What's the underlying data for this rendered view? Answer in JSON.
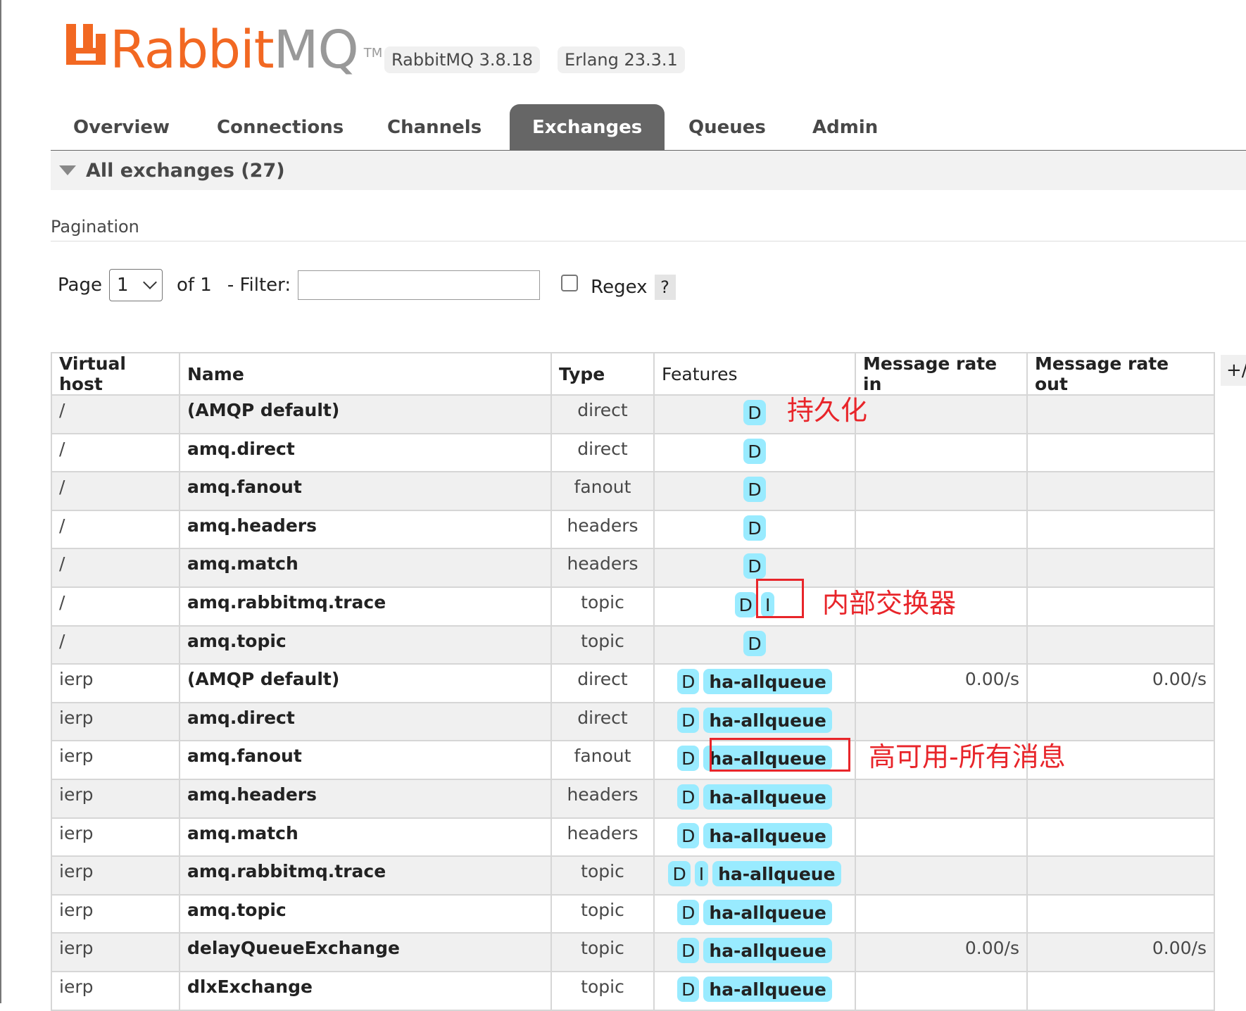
{
  "header": {
    "logo_text_rabbit": "Rabbit",
    "logo_text_mq": "MQ",
    "logo_tm": "TM",
    "version": "RabbitMQ 3.8.18",
    "erlang": "Erlang 23.3.1",
    "brand_color": "#f26822"
  },
  "tabs": [
    {
      "label": "Overview",
      "active": false
    },
    {
      "label": "Connections",
      "active": false
    },
    {
      "label": "Channels",
      "active": false
    },
    {
      "label": "Exchanges",
      "active": true
    },
    {
      "label": "Queues",
      "active": false
    },
    {
      "label": "Admin",
      "active": false
    }
  ],
  "section": {
    "title": "All exchanges (27)"
  },
  "pagination": {
    "label": "Pagination",
    "page_label": "Page",
    "page_value": "1",
    "of_label": "of 1",
    "filter_label": "- Filter:",
    "filter_value": "",
    "regex_label": "Regex",
    "regex_checked": false,
    "help_label": "?"
  },
  "table": {
    "columns": [
      "Virtual host",
      "Name",
      "Type",
      "Features",
      "Message rate in",
      "Message rate out"
    ],
    "toggle_label": "+/-",
    "rows": [
      {
        "vhost": "/",
        "name": "(AMQP default)",
        "type": "direct",
        "features": [
          "D"
        ],
        "policy": "",
        "rate_in": "",
        "rate_out": ""
      },
      {
        "vhost": "/",
        "name": "amq.direct",
        "type": "direct",
        "features": [
          "D"
        ],
        "policy": "",
        "rate_in": "",
        "rate_out": ""
      },
      {
        "vhost": "/",
        "name": "amq.fanout",
        "type": "fanout",
        "features": [
          "D"
        ],
        "policy": "",
        "rate_in": "",
        "rate_out": ""
      },
      {
        "vhost": "/",
        "name": "amq.headers",
        "type": "headers",
        "features": [
          "D"
        ],
        "policy": "",
        "rate_in": "",
        "rate_out": ""
      },
      {
        "vhost": "/",
        "name": "amq.match",
        "type": "headers",
        "features": [
          "D"
        ],
        "policy": "",
        "rate_in": "",
        "rate_out": ""
      },
      {
        "vhost": "/",
        "name": "amq.rabbitmq.trace",
        "type": "topic",
        "features": [
          "D",
          "I"
        ],
        "policy": "",
        "rate_in": "",
        "rate_out": ""
      },
      {
        "vhost": "/",
        "name": "amq.topic",
        "type": "topic",
        "features": [
          "D"
        ],
        "policy": "",
        "rate_in": "",
        "rate_out": ""
      },
      {
        "vhost": "ierp",
        "name": "(AMQP default)",
        "type": "direct",
        "features": [
          "D"
        ],
        "policy": "ha-allqueue",
        "rate_in": "0.00/s",
        "rate_out": "0.00/s"
      },
      {
        "vhost": "ierp",
        "name": "amq.direct",
        "type": "direct",
        "features": [
          "D"
        ],
        "policy": "ha-allqueue",
        "rate_in": "",
        "rate_out": ""
      },
      {
        "vhost": "ierp",
        "name": "amq.fanout",
        "type": "fanout",
        "features": [
          "D"
        ],
        "policy": "ha-allqueue",
        "rate_in": "",
        "rate_out": ""
      },
      {
        "vhost": "ierp",
        "name": "amq.headers",
        "type": "headers",
        "features": [
          "D"
        ],
        "policy": "ha-allqueue",
        "rate_in": "",
        "rate_out": ""
      },
      {
        "vhost": "ierp",
        "name": "amq.match",
        "type": "headers",
        "features": [
          "D"
        ],
        "policy": "ha-allqueue",
        "rate_in": "",
        "rate_out": ""
      },
      {
        "vhost": "ierp",
        "name": "amq.rabbitmq.trace",
        "type": "topic",
        "features": [
          "D",
          "I"
        ],
        "policy": "ha-allqueue",
        "rate_in": "",
        "rate_out": ""
      },
      {
        "vhost": "ierp",
        "name": "amq.topic",
        "type": "topic",
        "features": [
          "D"
        ],
        "policy": "ha-allqueue",
        "rate_in": "",
        "rate_out": ""
      },
      {
        "vhost": "ierp",
        "name": "delayQueueExchange",
        "type": "topic",
        "features": [
          "D"
        ],
        "policy": "ha-allqueue",
        "rate_in": "0.00/s",
        "rate_out": "0.00/s"
      },
      {
        "vhost": "ierp",
        "name": "dlxExchange",
        "type": "topic",
        "features": [
          "D"
        ],
        "policy": "ha-allqueue",
        "rate_in": "",
        "rate_out": ""
      }
    ]
  },
  "annotations": {
    "durable": "持久化",
    "internal": "内部交换器",
    "ha": "高可用-所有消息",
    "color": "#e8252a"
  }
}
